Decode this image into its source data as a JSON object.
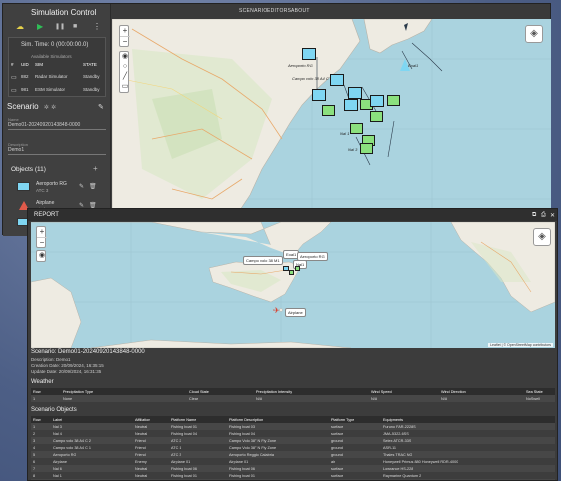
{
  "app": {
    "title": "Simulation Control",
    "nav": [
      "SCENARIO",
      "EDITORS",
      "ABOUT"
    ]
  },
  "controls": {
    "icons": [
      "cloud-upload-icon",
      "play-icon",
      "pause-icon",
      "stop-icon",
      "more-vertical-icon"
    ]
  },
  "sim": {
    "time_label": "Sim. Time: 0 (00:00:00.0)",
    "available_label": "Available Simulators",
    "columns": [
      "#",
      "UID",
      "SIM",
      "STATE"
    ],
    "rows": [
      {
        "uid": "882",
        "name": "Radar Simulator",
        "state": "Standby"
      },
      {
        "uid": "981",
        "name": "ESM Simulator",
        "state": "Standby"
      }
    ]
  },
  "scenario": {
    "heading": "Scenario",
    "name_label": "Name",
    "name_value": "Demo01-20240920143848-0000",
    "desc_label": "Description",
    "desc_value": "Demo1",
    "objects_heading": "Objects (11)",
    "objects": [
      {
        "name": "Aeroporto RG",
        "sub": "ATC 3",
        "color": "#7fd6f2"
      },
      {
        "name": "Airplane",
        "sub": "Airplane 01",
        "color": "#e05a4a"
      }
    ]
  },
  "map_back": {
    "labels": [
      "Eoal1",
      "Campo volo 38 A4 C",
      "Nal 1",
      "Nal 3",
      "Aeroporto RG"
    ]
  },
  "report": {
    "title": "REPORT",
    "window_icons": [
      "copy-icon",
      "print-icon",
      "close-icon"
    ],
    "map": {
      "popups": [
        "Campo volo 38 M1",
        "Eoal1",
        "Nal1",
        "Aeroporto RG",
        "Airplane"
      ],
      "attribution": "Leaflet | © OpenStreetMap contributors"
    },
    "scenario_line": "Scenario: Demo01-20240920143848-0000",
    "description_line": "Description: Demo1",
    "creation_line": "Creation Date: 20/09/2024, 16:35:15",
    "update_line": "Update Date: 20/09/2024, 16:31:35",
    "weather": {
      "heading": "Weather",
      "columns": [
        "Row",
        "Precipitation Type",
        "Cloud State",
        "Precipitation Intensity",
        "Wind Speed",
        "Wind Direction",
        "Sea State"
      ],
      "rows": [
        [
          "1",
          "None",
          "Clear",
          "N/A",
          "N/A",
          "N/A",
          "NoSwell"
        ]
      ]
    },
    "objects": {
      "heading": "Scenario Objects",
      "columns": [
        "Row",
        "Label",
        "Affiliation",
        "Platform Name",
        "Platform Description",
        "Platform Type",
        "Equipments"
      ],
      "rows": [
        [
          "1",
          "Nal 3",
          "Neutral",
          "Fishing boat 01",
          "Fishing boat 03",
          "surface",
          "Furuno FAR-2228S"
        ],
        [
          "2",
          "Nal 4",
          "Neutral",
          "Fishing boat 04",
          "Fishing boat 04",
          "surface",
          "JMA-5322-6SS"
        ],
        [
          "3",
          "Campo volo 38 A4 C 2",
          "Friend",
          "ATC 2",
          "Campo Volo 38° N Fly Zone",
          "ground",
          "Selex ATCR-33S"
        ],
        [
          "4",
          "Campo volo 38 A4 C 1",
          "Friend",
          "ATC 1",
          "Campo Volo 38° N Fly Zone",
          "ground",
          "ASR-11"
        ],
        [
          "5",
          "Aeroporto RG",
          "Friend",
          "ATC 3",
          "Aeroporto Reggio Calabria",
          "ground",
          "Thales TRAC NG"
        ],
        [
          "6",
          "Airplane",
          "Enemy",
          "Airplane 01",
          "Airplane 01",
          "air",
          "Honeywell Primus 880   Honeywell RDR-4000"
        ],
        [
          "7",
          "Nal 6",
          "Neutral",
          "Fishing boat 06",
          "Fishing boat 06",
          "surface",
          "Lowrance HS-228"
        ],
        [
          "8",
          "Nal 1",
          "Neutral",
          "Fishing boat 01",
          "Fishing boat 01",
          "surface",
          "Raymarine Quantum 2"
        ],
        [
          "9",
          "Eoal1",
          "Friend",
          "ESI Aircraft",
          "ESI Aircraft with a ESM",
          "surface",
          "ESM-S3-10"
        ]
      ]
    }
  }
}
